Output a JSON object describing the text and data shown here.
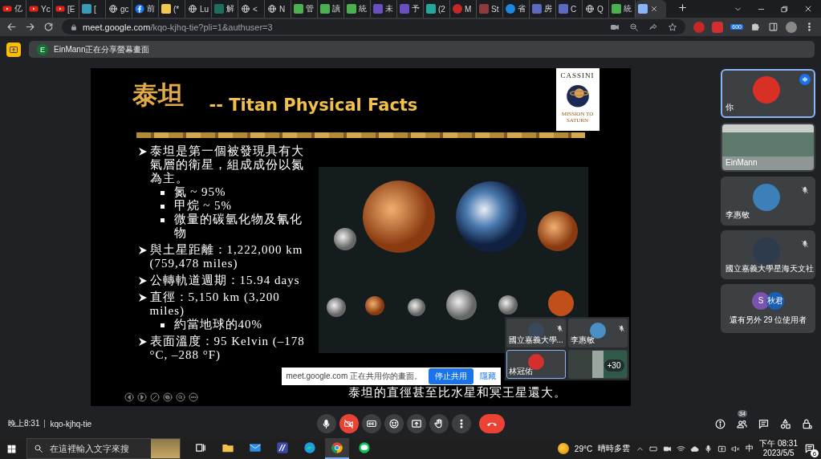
{
  "browser": {
    "tabs": [
      {
        "kind": "youtube",
        "label": "亿",
        "selected": false
      },
      {
        "kind": "youtube",
        "label": "Yc",
        "selected": false
      },
      {
        "kind": "youtube",
        "label": "[E",
        "selected": false
      },
      {
        "kind": "square",
        "color": "#3a9bb5",
        "label": "[",
        "selected": false
      },
      {
        "kind": "globe",
        "label": "gc",
        "selected": false
      },
      {
        "kind": "facebook",
        "label": "前",
        "selected": false
      },
      {
        "kind": "square",
        "color": "#f2c94c",
        "label": "(*",
        "selected": false
      },
      {
        "kind": "globe",
        "label": "Lu",
        "selected": false
      },
      {
        "kind": "square",
        "color": "#1e6e5e",
        "label": "解",
        "selected": false
      },
      {
        "kind": "globe",
        "label": "<",
        "selected": false
      },
      {
        "kind": "globe",
        "label": "N",
        "selected": false
      },
      {
        "kind": "square",
        "color": "#4caf50",
        "label": "管",
        "selected": false
      },
      {
        "kind": "square",
        "color": "#4caf50",
        "label": "讀",
        "selected": false
      },
      {
        "kind": "square",
        "color": "#4caf50",
        "label": "統",
        "selected": false
      },
      {
        "kind": "square",
        "color": "#6a4fc1",
        "label": "未",
        "selected": false
      },
      {
        "kind": "square",
        "color": "#6a4fc1",
        "label": "予",
        "selected": false
      },
      {
        "kind": "square",
        "color": "#26a69a",
        "label": "(2",
        "selected": false
      },
      {
        "kind": "round",
        "color": "#c62828",
        "label": "M",
        "selected": false
      },
      {
        "kind": "square",
        "color": "#8e3b3b",
        "label": "St",
        "selected": false
      },
      {
        "kind": "round",
        "color": "#1e88e5",
        "label": "省",
        "selected": false
      },
      {
        "kind": "square",
        "color": "#5c6bc0",
        "label": "房",
        "selected": false
      },
      {
        "kind": "square",
        "color": "#5c6bc0",
        "label": "C",
        "selected": false
      },
      {
        "kind": "globe",
        "label": "Q",
        "selected": false
      },
      {
        "kind": "square",
        "color": "#4caf50",
        "label": "統",
        "selected": false
      },
      {
        "kind": "square",
        "color": "#8ab4f8",
        "selected": true
      }
    ],
    "url": {
      "domain": "meet.google.com",
      "path": "/kqo-kjhq-tie?pli=1&authuser=3"
    },
    "extension_badge": "600"
  },
  "banner": {
    "initial": "E",
    "text": "EinMann正在分享螢幕畫面"
  },
  "slide": {
    "title_zh": "泰坦",
    "title_en": "-- Titan Physical Facts",
    "logo": {
      "name": "CASSINI",
      "tagline": "MISSION TO SATURN"
    },
    "bullets": [
      {
        "text": "泰坦是第一個被發現具有大氣層的衛星，組成成份以氮為主。",
        "children": [
          {
            "text": "氮 ~ 95%"
          },
          {
            "text": "甲烷 ~ 5%"
          },
          {
            "text": "微量的碳氫化物及氰化物"
          }
        ]
      },
      {
        "text": "與土星距離：1,222,000 km (759,478 miles)"
      },
      {
        "text": "公轉軌道週期：15.94 days"
      },
      {
        "text": "直徑：5,150 km (3,200 miles)",
        "children": [
          {
            "text": "約當地球的40%"
          }
        ]
      },
      {
        "text": "表面溫度：95 Kelvin (–178 °C, –288 °F)"
      }
    ],
    "caption": "泰坦的直徑甚至比水星和冥王星還大。"
  },
  "share_notice": {
    "text": "meet.google.com 正在共用你的畫面。",
    "stop_button": "停止共用",
    "hide_link": "隱藏"
  },
  "mini_tiles": [
    {
      "kind": "avatar",
      "name": "國立嘉義大學...",
      "color": "#3a4a5a",
      "muted": true,
      "selected": false
    },
    {
      "kind": "avatar",
      "name": "李惠敏",
      "color": "#4a90c8",
      "muted": true,
      "selected": false
    },
    {
      "kind": "avatar",
      "name": "林冠佑",
      "color": "#d32f2f",
      "muted": false,
      "selected": true
    },
    {
      "kind": "video",
      "count": "+30",
      "selected": false
    }
  ],
  "participants": [
    {
      "kind": "avatar",
      "name": "你",
      "color": "#d93025",
      "speaking": true,
      "muted": false,
      "selected": true
    },
    {
      "kind": "video",
      "name": "EinMann",
      "selected": false
    },
    {
      "kind": "avatar",
      "name": "李惠敏",
      "color": "#3d7fb8",
      "speaking": false,
      "muted": true,
      "selected": false
    },
    {
      "kind": "avatar",
      "name": "國立嘉義大學星海天文社",
      "color": "#2e3b4c",
      "speaking": false,
      "muted": true,
      "selected": false
    },
    {
      "kind": "others",
      "avatars": [
        {
          "initial": "S",
          "color": "#7b52ae"
        },
        {
          "initial": "秋君",
          "color": "#1a5fb4"
        }
      ],
      "text": "還有另外 29 位使用者",
      "selected": false
    }
  ],
  "meeting_bar": {
    "time": "晚上8:31",
    "code": "kqo-kjhq-tie",
    "controls": [
      {
        "kind": "mic",
        "on": true
      },
      {
        "kind": "camera",
        "on": false
      },
      {
        "kind": "captions"
      },
      {
        "kind": "emoji"
      },
      {
        "kind": "present"
      },
      {
        "kind": "hand"
      },
      {
        "kind": "more"
      },
      {
        "kind": "leave"
      }
    ],
    "people_count": "34"
  },
  "taskbar": {
    "search_placeholder": "在這裡輸入文字來搜",
    "apps": [
      {
        "kind": "task-view",
        "selected": false
      },
      {
        "kind": "explorer",
        "selected": false
      },
      {
        "kind": "mail",
        "selected": false
      },
      {
        "kind": "editor",
        "selected": false
      },
      {
        "kind": "edge",
        "selected": false
      },
      {
        "kind": "chrome",
        "selected": true
      },
      {
        "kind": "line",
        "selected": false
      }
    ],
    "temperature": "29°C",
    "weather": "晴時多雲",
    "ime": "中",
    "time": "下午 08:31",
    "date": "2023/5/5",
    "notifications": "6"
  }
}
